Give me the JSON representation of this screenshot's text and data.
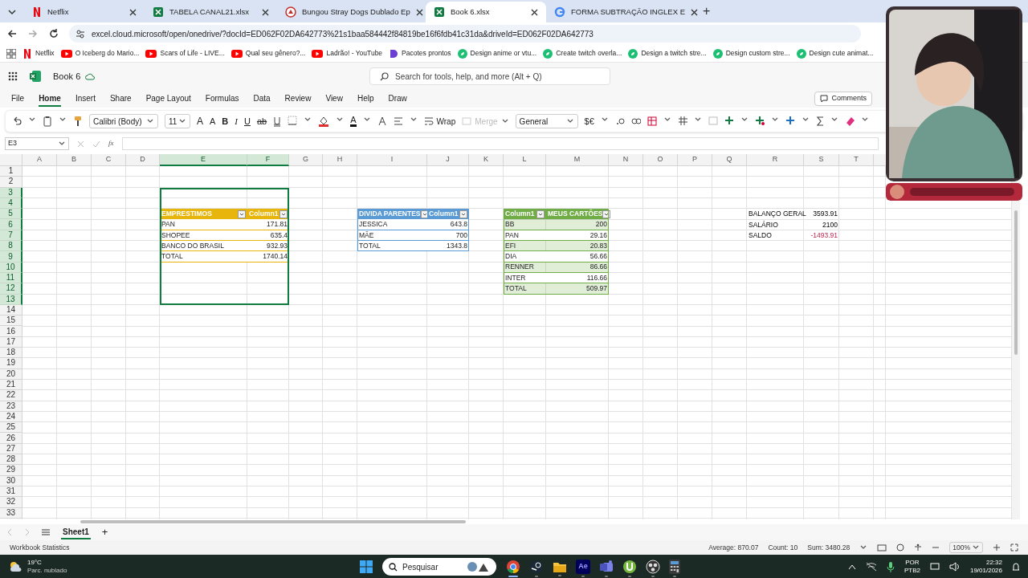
{
  "browser": {
    "tabs": [
      {
        "kind": "netflix",
        "title": "Netflix",
        "selected": false
      },
      {
        "kind": "excel",
        "title": "TABELA CANAL21.xlsx",
        "selected": false
      },
      {
        "kind": "site",
        "title": "Bungou Stray Dogs Dublado Ep",
        "selected": false
      },
      {
        "kind": "excel",
        "title": "Book 6.xlsx",
        "selected": true
      },
      {
        "kind": "google",
        "title": "FORMA SUBTRAÇÃO INGLEX E",
        "selected": false
      }
    ],
    "new_tab": "+",
    "url": "excel.cloud.microsoft/open/onedrive/?docId=ED062F02DA642773%21s1baa584442f84819be16f6fdb41c31da&driveId=ED062F02DA642773",
    "bookmarks": [
      {
        "kind": "netflix",
        "label": "Netflix"
      },
      {
        "kind": "youtube",
        "label": "O Iceberg do Mario..."
      },
      {
        "kind": "youtube",
        "label": "Scars of Life - LIVE..."
      },
      {
        "kind": "youtube",
        "label": "Qual seu gênero?..."
      },
      {
        "kind": "youtube",
        "label": "Ladrão! - YouTube"
      },
      {
        "kind": "moon",
        "label": "Pacotes prontos"
      },
      {
        "kind": "leaf",
        "label": "Design anime or vtu..."
      },
      {
        "kind": "leaf",
        "label": "Create twitch overla..."
      },
      {
        "kind": "leaf",
        "label": "Design a twitch stre..."
      },
      {
        "kind": "leaf",
        "label": "Design custom stre..."
      },
      {
        "kind": "leaf",
        "label": "Design cute animat..."
      }
    ]
  },
  "app": {
    "title": "Book 6",
    "search": {
      "placeholder": "Search for tools, help, and more (Alt + Q)"
    },
    "ribbon_tabs": [
      {
        "label": "File",
        "selected": false
      },
      {
        "label": "Home",
        "selected": true
      },
      {
        "label": "Insert",
        "selected": false
      },
      {
        "label": "Share",
        "selected": false
      },
      {
        "label": "Page Layout",
        "selected": false
      },
      {
        "label": "Formulas",
        "selected": false
      },
      {
        "label": "Data",
        "selected": false
      },
      {
        "label": "Review",
        "selected": false
      },
      {
        "label": "View",
        "selected": false
      },
      {
        "label": "Help",
        "selected": false
      },
      {
        "label": "Draw",
        "selected": false
      }
    ],
    "comments": "Comments",
    "toolbar": {
      "font": "Calibri (Body)",
      "size": "11",
      "grow": "A",
      "shrink": "A",
      "bold": "B",
      "italic": "I",
      "underline": "U",
      "strike": "ab",
      "font_color": "A",
      "wrap": "Wrap",
      "merge": {
        "label": "Merge",
        "disabled": true
      },
      "number_format": "General",
      "currency": "$€"
    },
    "name_box": "E3",
    "fx": "fx"
  },
  "sheet": {
    "columns": [
      {
        "label": "A",
        "selected": false
      },
      {
        "label": "B",
        "selected": false
      },
      {
        "label": "C",
        "selected": false
      },
      {
        "label": "D",
        "selected": false
      },
      {
        "label": "E",
        "selected": true
      },
      {
        "label": "F",
        "selected": true
      },
      {
        "label": "G",
        "selected": false
      },
      {
        "label": "H",
        "selected": false
      },
      {
        "label": "I",
        "selected": false
      },
      {
        "label": "J",
        "selected": false
      },
      {
        "label": "K",
        "selected": false
      },
      {
        "label": "L",
        "selected": false
      },
      {
        "label": "M",
        "selected": false
      },
      {
        "label": "N",
        "selected": false
      },
      {
        "label": "O",
        "selected": false
      },
      {
        "label": "P",
        "selected": false
      },
      {
        "label": "Q",
        "selected": false
      },
      {
        "label": "R",
        "selected": false
      },
      {
        "label": "S",
        "selected": false
      },
      {
        "label": "T",
        "selected": false
      }
    ],
    "rows": [
      {
        "label": "1",
        "selected": false
      },
      {
        "label": "2",
        "selected": false
      },
      {
        "label": "3",
        "selected": true
      },
      {
        "label": "4",
        "selected": true
      },
      {
        "label": "5",
        "selected": true
      },
      {
        "label": "6",
        "selected": true
      },
      {
        "label": "7",
        "selected": true
      },
      {
        "label": "8",
        "selected": true
      },
      {
        "label": "9",
        "selected": true
      },
      {
        "label": "10",
        "selected": true
      },
      {
        "label": "11",
        "selected": true
      },
      {
        "label": "12",
        "selected": true
      },
      {
        "label": "13",
        "selected": true
      },
      {
        "label": "14",
        "selected": false
      },
      {
        "label": "15",
        "selected": false
      },
      {
        "label": "16",
        "selected": false
      },
      {
        "label": "17",
        "selected": false
      },
      {
        "label": "18",
        "selected": false
      },
      {
        "label": "19",
        "selected": false
      },
      {
        "label": "20",
        "selected": false
      },
      {
        "label": "21",
        "selected": false
      },
      {
        "label": "22",
        "selected": false
      },
      {
        "label": "23",
        "selected": false
      },
      {
        "label": "24",
        "selected": false
      },
      {
        "label": "25",
        "selected": false
      },
      {
        "label": "26",
        "selected": false
      },
      {
        "label": "27",
        "selected": false
      },
      {
        "label": "28",
        "selected": false
      },
      {
        "label": "29",
        "selected": false
      },
      {
        "label": "30",
        "selected": false
      },
      {
        "label": "31",
        "selected": false
      },
      {
        "label": "32",
        "selected": false
      },
      {
        "label": "33",
        "selected": false
      }
    ],
    "tables": [
      {
        "color": "#e8b50c",
        "banded": false,
        "columns": [
          {
            "label": "EMPRESTIMOS",
            "numeric": false
          },
          {
            "label": "Column1",
            "numeric": true
          }
        ],
        "rows": [
          [
            "PAN",
            "171.81"
          ],
          [
            "SHOPEE",
            "635.4"
          ],
          [
            "BANCO DO BRASIL",
            "932.93"
          ],
          [
            "TOTAL",
            "1740.14"
          ]
        ]
      },
      {
        "color": "#5b9bd5",
        "banded": false,
        "columns": [
          {
            "label": "DIVIDA PARENTES",
            "numeric": false
          },
          {
            "label": "Column1",
            "numeric": true
          }
        ],
        "rows": [
          [
            "JESSICA",
            "643.8"
          ],
          [
            "MÃE",
            "700"
          ],
          [
            "TOTAL",
            "1343.8"
          ]
        ]
      },
      {
        "color": "#70ad47",
        "banded": true,
        "columns": [
          {
            "label": "Column1",
            "numeric": false
          },
          {
            "label": "MEUS CARTÕES",
            "numeric": true
          }
        ],
        "rows": [
          [
            "BB",
            "200"
          ],
          [
            "PAN",
            "29.16"
          ],
          [
            "EFI",
            "20.83"
          ],
          [
            "DIA",
            "56.66"
          ],
          [
            "RENNER",
            "86.66"
          ],
          [
            "INTER",
            "116.66"
          ],
          [
            "TOTAL",
            "509.97"
          ]
        ]
      }
    ],
    "summary": [
      {
        "label": "BALANÇO GERAL",
        "value": "3593.91",
        "negative": false
      },
      {
        "label": "SALÁRIO",
        "value": "2100",
        "negative": false
      },
      {
        "label": "SALDO",
        "value": "-1493.91",
        "negative": true
      }
    ],
    "sheet_tabs": [
      {
        "label": "Sheet1",
        "selected": true
      }
    ],
    "add_sheet": "+"
  },
  "status_bar": {
    "left": "Workbook Statistics",
    "average": "Average: 870.07",
    "count": "Count: 10",
    "sum": "Sum: 3480.28",
    "zoom": "100%"
  },
  "taskbar": {
    "temperature": "19°C",
    "weather": "Parc. nublado",
    "search": "Pesquisar",
    "apps": [
      {
        "kind": "chrome",
        "selected": true
      },
      {
        "kind": "steam",
        "selected": false
      },
      {
        "kind": "folder",
        "selected": false
      },
      {
        "kind": "ae",
        "label": "Ae",
        "selected": false
      },
      {
        "kind": "teams",
        "selected": false
      },
      {
        "kind": "torrent",
        "selected": false
      },
      {
        "kind": "obs",
        "selected": false
      },
      {
        "kind": "calculator",
        "selected": false
      }
    ],
    "language": "POR",
    "layout": "PTB2",
    "time": "22:32",
    "date": "19/01/2026"
  }
}
